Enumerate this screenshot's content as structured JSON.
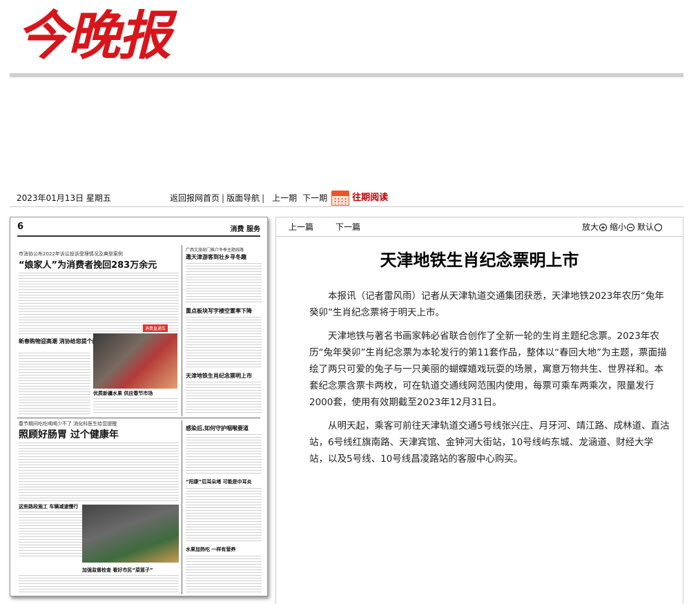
{
  "masthead": {
    "logo_text": "今晚报"
  },
  "nav": {
    "date": "2023年01月13日 星期五",
    "home": "返回报网首页",
    "layout": "版面导航",
    "prev_issue": "上一期",
    "next_issue": "下一期",
    "past_reading": "往期阅读"
  },
  "newspaper_page": {
    "page_number": "6",
    "section": "消费 服务",
    "kicker1": "市消协公布2022年诉讼投诉受理情况及典型案例",
    "headline1": "“娘家人”为消费者挽回283万余元",
    "headline2": "新春购物迎高潮 消协给您提个醒",
    "caption1": "优质新疆水果 供应春节市场",
    "kicker2": "广西文旅部门推介冬季主题线路",
    "headline3": "邀天津游客到壮乡寻冬趣",
    "headline4": "重点板块写字楼空置率下降",
    "headline5": "天津地铁生肖纪念票明上市",
    "kicker3": "春节期间吃吃喝喝少不了 消化科医生给您提醒",
    "headline6": "照顾好肠胃 过个健康年",
    "headline7": "感染后,如何守护咽喉要道",
    "headline8": "“阳康”后耳朵堵 可能是中耳炎",
    "headline9": "这些路段施工 车辆减速慢行",
    "headline10": "水果加热吃 一样有营养",
    "caption2": "加强监督检查 看好市民“菜篮子”",
    "badge": "消费直通车"
  },
  "article": {
    "prev": "上一篇",
    "next": "下一篇",
    "zoom_in": "放大",
    "zoom_out": "缩小",
    "zoom_default": "默认",
    "title": "天津地铁生肖纪念票明上市",
    "paragraphs": [
      "本报讯（记者雷风雨）记者从天津轨道交通集团获悉，天津地铁2023年农历“兔年癸卯”生肖纪念票将于明天上市。",
      "天津地铁与著名书画家韩必省联合创作了全新一轮的生肖主题纪念票。2023年农历“兔年癸卯”生肖纪念票为本轮发行的第11套作品，整体以“春回大地”为主题，票面描绘了两只可爱的兔子与一只美丽的蝴蝶嬉戏玩耍的场景，寓意万物共生、世界祥和。本套纪念票含票卡两枚，可在轨道交通线网范围内使用，每票可乘车两乘次，限量发行2000套，使用有效期截至2023年12月31日。",
      "从明天起，乘客可前往天津轨道交通5号线张兴庄、月牙河、靖江路、成林道、直沽站，6号线红旗南路、天津宾馆、金钟河大街站，10号线屿东城、龙涵道、财经大学站，以及5号线、10号线昌凌路站的客服中心购买。"
    ]
  }
}
